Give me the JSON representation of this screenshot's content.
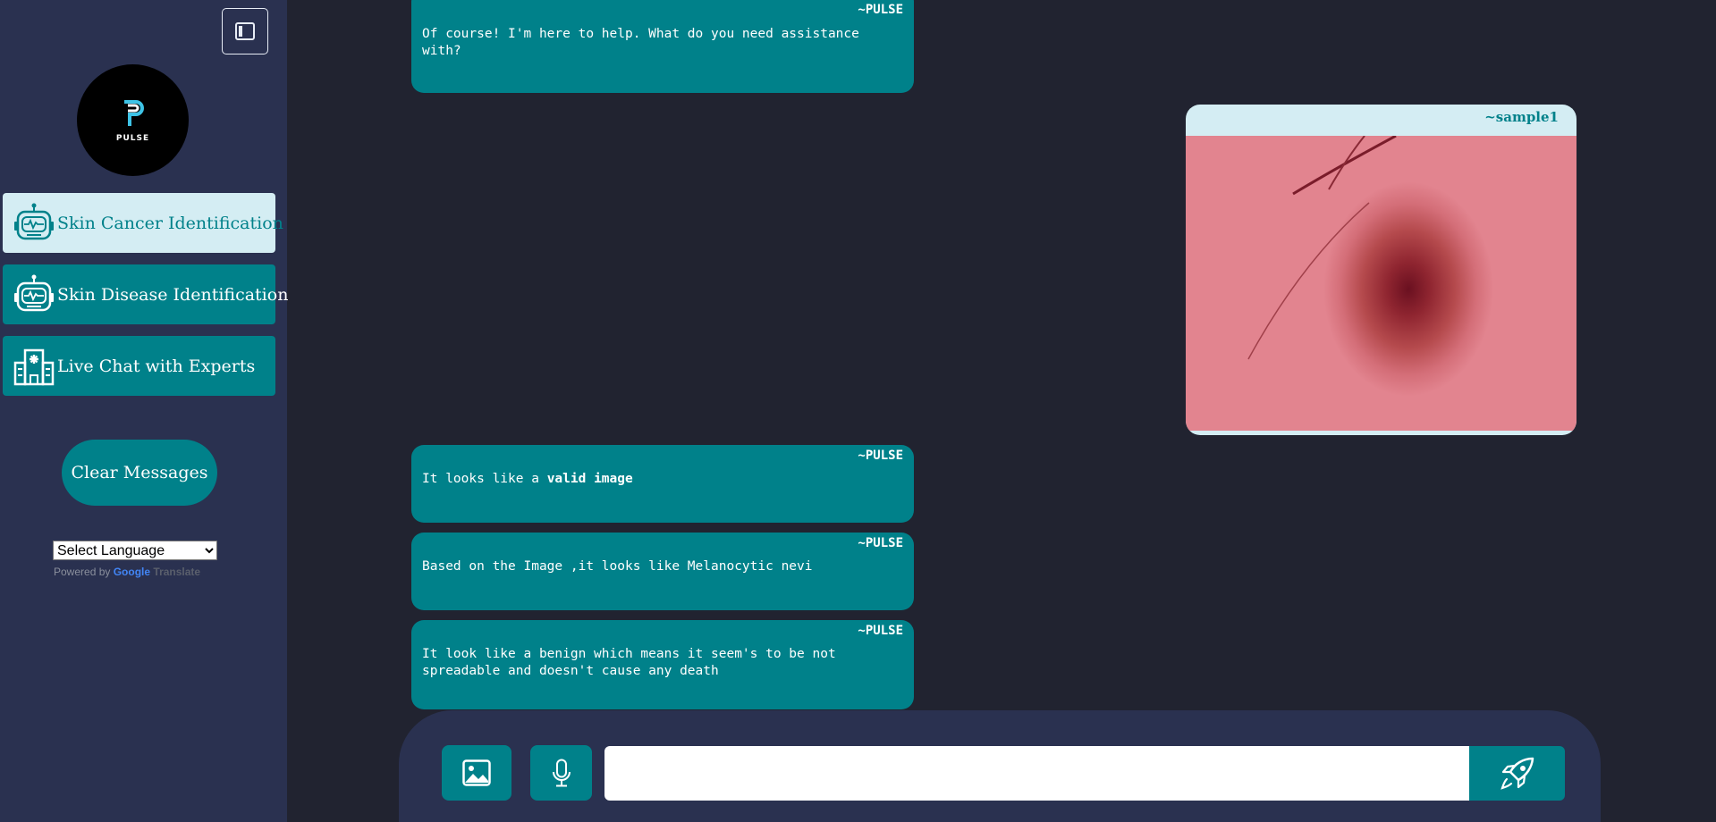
{
  "sidebar": {
    "toggle_icon": "sidebar-toggle-icon",
    "logo_text": "PULSE",
    "nav": [
      {
        "label": "Skin Cancer Identification",
        "icon": "robot-icon",
        "active": true
      },
      {
        "label": "Skin Disease Identification",
        "icon": "robot-icon",
        "active": false
      },
      {
        "label": "Live Chat with Experts",
        "icon": "hospital-icon",
        "active": false
      }
    ],
    "clear_label": "Clear Messages",
    "language": {
      "selected": "Select Language",
      "powered_by": "Powered by",
      "google": "Google",
      "translate": "Translate"
    }
  },
  "chat": {
    "messages": [
      {
        "sender": "~PULSE",
        "text": "Of course! I'm here to help. What do you need assistance with?"
      },
      {
        "sender": "~PULSE",
        "text_prefix": "It looks like a ",
        "text_bold": "valid image"
      },
      {
        "sender": "~PULSE",
        "text": "Based on the Image ,it looks like Melanocytic nevi"
      },
      {
        "sender": "~PULSE",
        "text": "It look like a benign which means it seem's to be not spreadable and doesn't cause any death"
      }
    ],
    "image_message": {
      "sender": "~sample1",
      "content": "skin lesion photo"
    }
  },
  "composer": {
    "image_icon": "image-icon",
    "mic_icon": "microphone-icon",
    "send_icon": "rocket-icon",
    "input_value": "",
    "input_placeholder": ""
  },
  "colors": {
    "teal": "#00818a",
    "sidebar_bg": "#2a3150",
    "main_bg": "#212330",
    "active_nav": "#d4edf3"
  }
}
